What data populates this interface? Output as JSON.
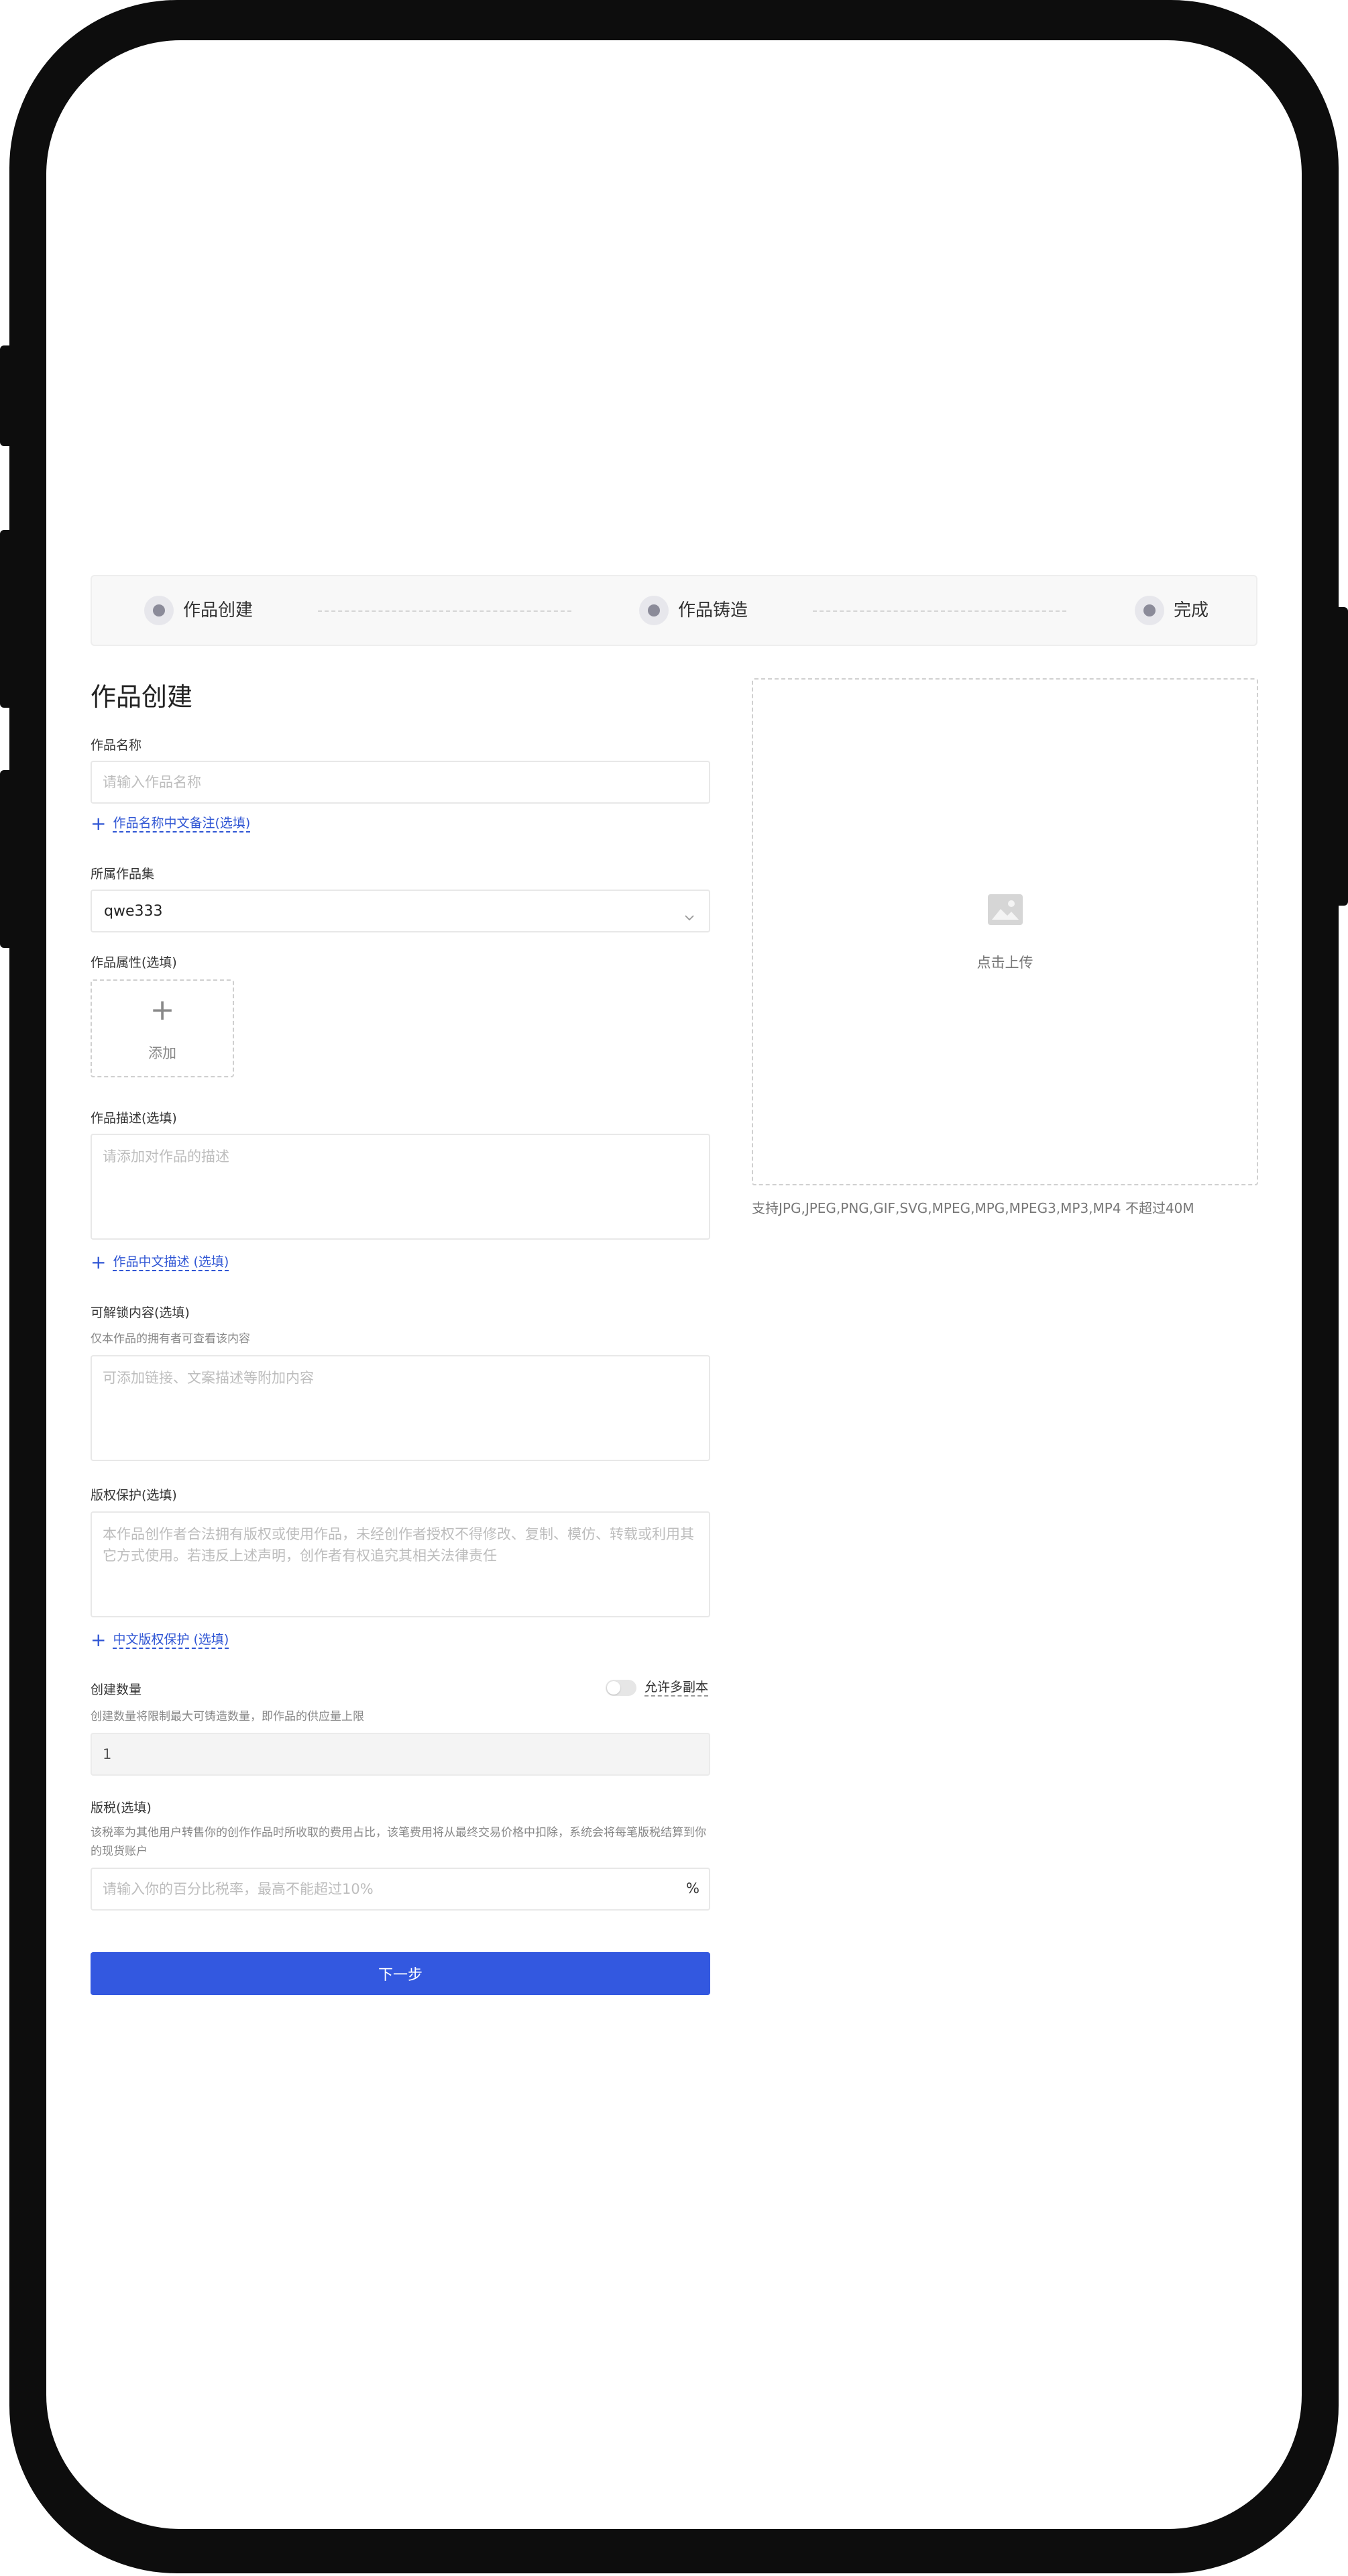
{
  "steps": [
    {
      "label": "作品创建"
    },
    {
      "label": "作品铸造"
    },
    {
      "label": "完成"
    }
  ],
  "page_title": "作品创建",
  "form": {
    "name_label": "作品名称",
    "name_placeholder": "请输入作品名称",
    "name_cn_link": "作品名称中文备注(选填)",
    "collection_label": "所属作品集",
    "collection_value": "qwe333",
    "attributes_label": "作品属性(选填)",
    "attributes_add": "添加",
    "description_label": "作品描述(选填)",
    "description_placeholder": "请添加对作品的描述",
    "description_cn_link": "作品中文描述 (选填)",
    "unlockable_label": "可解锁内容(选填)",
    "unlockable_hint": "仅本作品的拥有者可查看该内容",
    "unlockable_placeholder": "可添加链接、文案描述等附加内容",
    "copyright_label": "版权保护(选填)",
    "copyright_placeholder": "本作品创作者合法拥有版权或使用作品，未经创作者授权不得修改、复制、模仿、转载或利用其它方式使用。若违反上述声明，创作者有权追究其相关法律责任",
    "copyright_cn_link": "中文版权保护 (选填)",
    "quantity_label": "创建数量",
    "quantity_toggle_label": "允许多副本",
    "quantity_hint": "创建数量将限制最大可铸造数量，即作品的供应量上限",
    "quantity_value": "1",
    "royalty_label": "版税(选填)",
    "royalty_hint": "该税率为其他用户转售你的创作作品时所收取的费用占比，该笔费用将从最终交易价格中扣除，系统会将每笔版税结算到你的现货账户",
    "royalty_placeholder": "请输入你的百分比税率，最高不能超过10%",
    "royalty_suffix": "%",
    "next_button": "下一步"
  },
  "upload": {
    "label": "点击上传",
    "hint": "支持JPG,JPEG,PNG,GIF,SVG,MPEG,MPG,MPEG3,MP3,MP4 不超过40M"
  },
  "colors": {
    "primary": "#3358e0",
    "link": "#2f55d4",
    "frame": "#0d0d0d"
  }
}
